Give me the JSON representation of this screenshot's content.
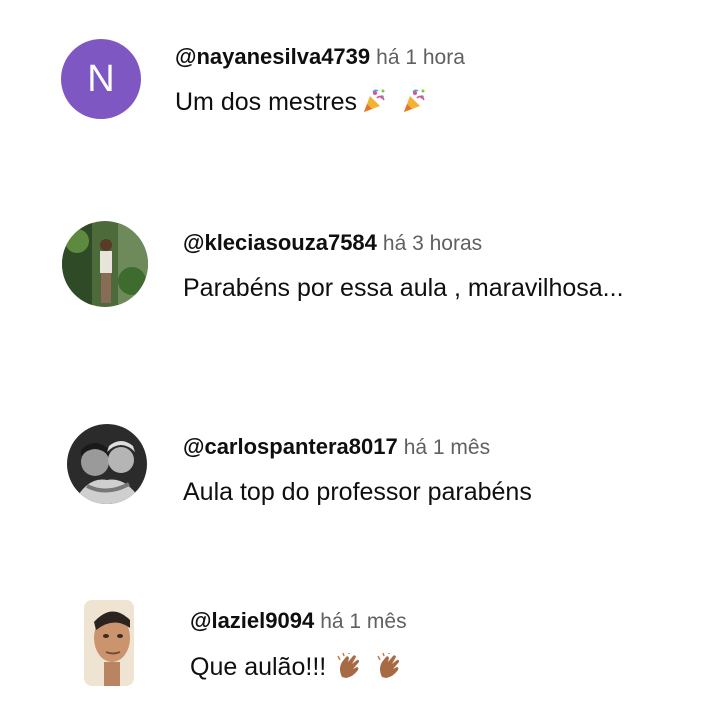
{
  "comments": [
    {
      "handle": "@nayanesilva4739",
      "time": "há 1 hora",
      "text": "Um dos mestres",
      "avatar_letter": "N",
      "avatar_color": "#7e57c2",
      "emojis": [
        "party-popper-icon",
        "party-popper-icon"
      ]
    },
    {
      "handle": "@kleciasouza7584",
      "time": "há 3 horas",
      "text": "Parabéns por essa aula , maravilhosa...",
      "avatar": "photo-woman-garden"
    },
    {
      "handle": "@carlospantera8017",
      "time": "há 1 mês",
      "text": "Aula top do professor parabéns",
      "avatar": "photo-couple-bw"
    },
    {
      "handle": "@laziel9094",
      "time": "há 1 mês",
      "text": "Que aulão!!!",
      "avatar": "photo-man-portrait",
      "emojis": [
        "clapping-hands-icon",
        "clapping-hands-icon"
      ]
    }
  ]
}
